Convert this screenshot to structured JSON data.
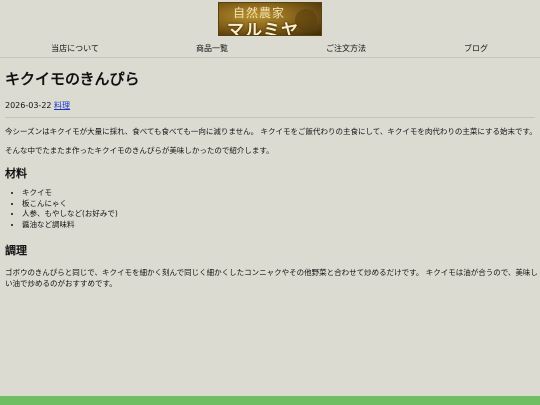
{
  "header": {
    "logo_text_line1": "自然農家",
    "logo_text_line2": "マルミヤ"
  },
  "nav": {
    "items": [
      {
        "label": "当店について"
      },
      {
        "label": "商品一覧"
      },
      {
        "label": "ご注文方法"
      },
      {
        "label": "ブログ"
      }
    ]
  },
  "article": {
    "title": "キクイモのきんぴら",
    "date": "2026-03-22",
    "category": "料理",
    "intro": [
      "今シーズンはキクイモが大量に採れ、食べても食べても一向に減りません。 キクイモをご飯代わりの主食にして、キクイモを肉代わりの主菜にする始末です。",
      "そんな中でたまたま作ったキクイモのきんぴらが美味しかったので紹介します。"
    ],
    "ingredients_heading": "材料",
    "ingredients": [
      "キクイモ",
      "板こんにゃく",
      "人参、もやしなど(お好みで)",
      "醤油など調味料"
    ],
    "method_heading": "調理",
    "method": [
      "ゴボウのきんぴらと同じで、キクイモを細かく刻んで同じく細かくしたコンニャクやその他野菜と合わせて炒めるだけです。 キクイモは油が合うので、美味し",
      "い油で炒めるのがおすすめです。"
    ]
  },
  "colors": {
    "background": "#dcdbd2",
    "link": "#1a35c9",
    "footer_bar": "#6fbe63"
  }
}
